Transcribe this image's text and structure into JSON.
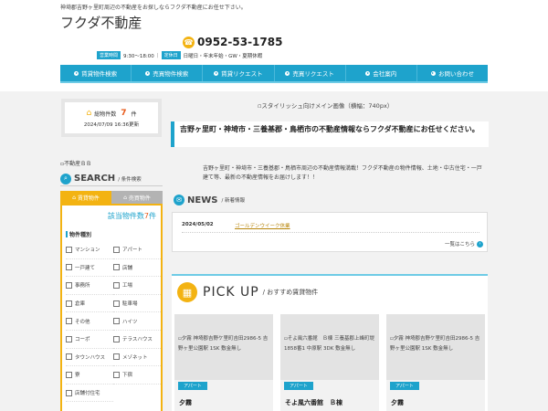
{
  "header": {
    "tagline": "神埼郡吉野ヶ里町周辺の不動産をお探しならフクダ不動産にお任せ下さい。",
    "site_title": "フクダ不動産",
    "phone": "0952-53-1785",
    "hours_tag": "営業時間",
    "hours": "9:30～18:00",
    "closed_tag": "定休日",
    "closed": "日曜日・年末年始・GW・夏期休暇"
  },
  "nav": [
    {
      "label": "賃貸物件検索"
    },
    {
      "label": "売買物件検索"
    },
    {
      "label": "賃貸リクエスト"
    },
    {
      "label": "売買リクエスト"
    },
    {
      "label": "会社案内"
    },
    {
      "label": "お問い合わせ"
    }
  ],
  "sidebar": {
    "total_label": "総物件数",
    "total_count": "7",
    "total_unit": "件",
    "updated": "2024/07/09 16:36更新",
    "banner_alt": "不動産ＢＢ",
    "search_title": "SEARCH",
    "search_sub": "/ 条件検索",
    "tab_rent": "賃貸物件",
    "tab_sale": "売買物件",
    "match_prefix": "該当物件数",
    "match_count": "7",
    "match_suffix": "件",
    "type_label": "物件種別",
    "types": [
      "マンション",
      "アパート",
      "一戸建て",
      "店舗",
      "事務所",
      "工場",
      "倉庫",
      "駐車場",
      "その他",
      "ハイツ",
      "コーポ",
      "テラスハウス",
      "タウンハウス",
      "メゾネット",
      "寮",
      "下宿",
      "店舗付住宅",
      ""
    ]
  },
  "main": {
    "image_alt": "スタイリッシュ向けメイン画像（横幅：740px）",
    "lead": "吉野ヶ里町・神埼市・三養基郡・鳥栖市の不動産情報ならフクダ不動産にお任せください。",
    "intro": "吉野ヶ里町・神埼市・三養基郡・鳥栖市周辺の不動産情報満載！フクダ不動産の物件情報、土地・中古住宅・一戸建て等、最新の不動産情報をお届けします！！",
    "news_title": "NEWS",
    "news_sub": "/ 新着情報",
    "news": [
      {
        "date": "2024/05/02",
        "title": "ゴールデンウイーク休業"
      }
    ],
    "news_more": "一覧はこちら",
    "pickup_title": "PICK UP",
    "pickup_sub": "/ おすすめ賃貸物件",
    "pickups": [
      {
        "alt": "夕霧 神埼郡吉野ケ里町吉田2986-5 吉野ヶ里公園駅 1SK 敷金無し",
        "badge": "アパート",
        "name": "夕霧"
      },
      {
        "alt": "そよ風六番館　Ｂ棟 三養基郡上峰町堤1858番1 中原駅 3DK 敷金無し",
        "badge": "アパート",
        "name": "そよ風六番館　Ｂ棟"
      },
      {
        "alt": "夕霧 神埼郡吉野ケ里町吉田2986-5 吉野ヶ里公園駅 1SK 敷金無し",
        "badge": "アパート",
        "name": "夕霧"
      }
    ]
  },
  "colors": {
    "accent": "#1ea3cc",
    "highlight": "#f3b312",
    "count": "#e85a1a"
  },
  "icons": {
    "phone": "phone-icon",
    "search": "search-icon",
    "house": "house-icon",
    "news": "news-icon",
    "building": "building-icon"
  }
}
